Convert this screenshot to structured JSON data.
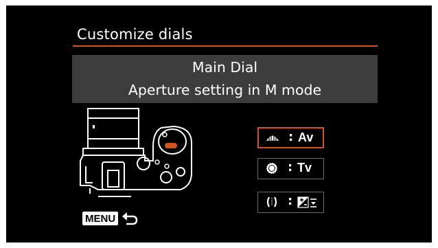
{
  "screen": {
    "title": "Customize dials",
    "accent_color": "#d0561d",
    "header": {
      "dial_name": "Main Dial",
      "description": "Aperture setting in M mode"
    }
  },
  "options": [
    {
      "icon": "main-dial-icon",
      "separator": ":",
      "value": "Av",
      "selected": true
    },
    {
      "icon": "quick-control-dial-icon",
      "separator": ":",
      "value": "Tv",
      "selected": false
    },
    {
      "icon": "control-ring-icon",
      "separator": ":",
      "value": "",
      "value_icon": "exposure-compensation-icon",
      "selected": false
    }
  ],
  "footer": {
    "menu_label": "MENU",
    "back_icon": "return-arrow-icon"
  }
}
